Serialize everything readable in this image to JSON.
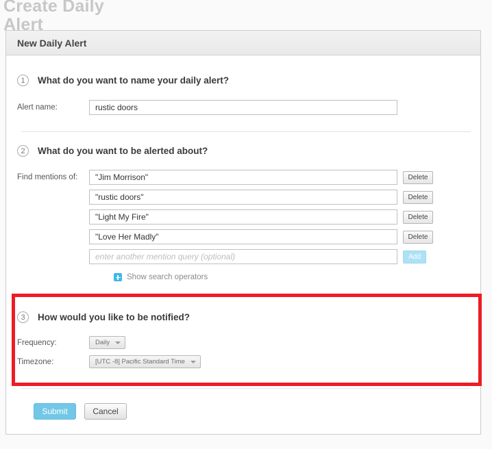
{
  "page": {
    "heading": "Create Daily Alert"
  },
  "panel": {
    "header_title": "New Daily Alert"
  },
  "steps": [
    {
      "number": "1",
      "title": "What do you want to name your daily alert?",
      "field_label": "Alert name:",
      "alert_name_value": "rustic doors"
    },
    {
      "number": "2",
      "title": "What do you want to be alerted about?",
      "field_label": "Find mentions of:",
      "queries": [
        {
          "value": "\"Jim Morrison\"",
          "delete_label": "Delete"
        },
        {
          "value": "\"rustic doors\"",
          "delete_label": "Delete"
        },
        {
          "value": "\"Light My Fire\"",
          "delete_label": "Delete"
        },
        {
          "value": "\"Love Her Madly\"",
          "delete_label": "Delete"
        }
      ],
      "new_query_placeholder": "enter another mention query (optional)",
      "new_query_value": "",
      "add_label": "Add",
      "show_operators_label": "Show search operators",
      "plus_icon": "plus-icon"
    },
    {
      "number": "3",
      "title": "How would you like to be notified?",
      "frequency_label": "Frequency:",
      "frequency_value": "Daily",
      "timezone_label": "Timezone:",
      "timezone_value": "[UTC -8] Pacific Standard Time"
    }
  ],
  "footer": {
    "submit_label": "Submit",
    "cancel_label": "Cancel"
  },
  "colors": {
    "highlight": "#ed1c24",
    "accent_blue": "#72c7e7",
    "add_blue": "#ade2f5",
    "plus_blue": "#3db8e8"
  }
}
